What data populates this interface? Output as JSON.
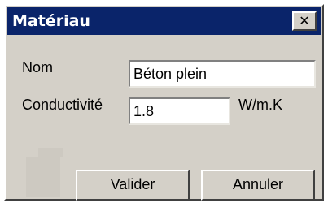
{
  "window": {
    "title": "Matériau",
    "close_label": "✕"
  },
  "form": {
    "name_label": "Nom",
    "name_value": "Béton plein",
    "conductivity_label": "Conductivité",
    "conductivity_value": "1.8",
    "conductivity_unit": "W/m.K"
  },
  "buttons": {
    "validate": "Valider",
    "cancel": "Annuler"
  },
  "colors": {
    "titlebar": "#0a246a",
    "dialog_face": "#d4d0c8",
    "field_bg": "#ffffff"
  }
}
